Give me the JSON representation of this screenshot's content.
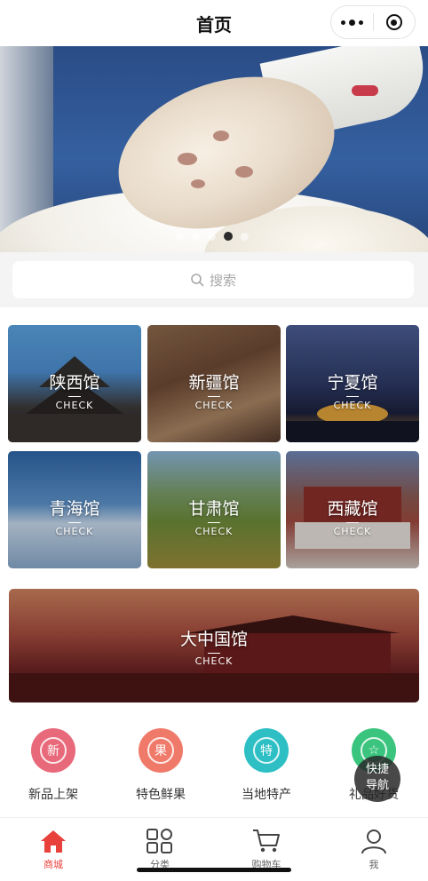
{
  "header": {
    "title": "首页"
  },
  "banner": {
    "slides_total": 5,
    "active_slide": 4
  },
  "search": {
    "placeholder": "搜索"
  },
  "pavilions": [
    {
      "name": "陕西馆",
      "action": "CHECK"
    },
    {
      "name": "新疆馆",
      "action": "CHECK"
    },
    {
      "name": "宁夏馆",
      "action": "CHECK"
    },
    {
      "name": "青海馆",
      "action": "CHECK"
    },
    {
      "name": "甘肃馆",
      "action": "CHECK"
    },
    {
      "name": "西藏馆",
      "action": "CHECK"
    }
  ],
  "featured": {
    "name": "大中国馆",
    "action": "CHECK"
  },
  "categories": [
    {
      "label": "新品上架",
      "glyph": "新",
      "color": "#e8697a"
    },
    {
      "label": "特色鲜果",
      "glyph": "果",
      "color": "#f07a6a"
    },
    {
      "label": "当地特产",
      "glyph": "特",
      "color": "#2dbfc4"
    },
    {
      "label": "礼品好货",
      "glyph": "☆",
      "color": "#3ac47d"
    }
  ],
  "quick_nav": {
    "line1": "快捷",
    "line2": "导航"
  },
  "tabbar": [
    {
      "label": "商城",
      "icon": "home-icon",
      "active": true
    },
    {
      "label": "分类",
      "icon": "grid-icon",
      "active": false
    },
    {
      "label": "购物车",
      "icon": "cart-icon",
      "active": false
    },
    {
      "label": "我",
      "icon": "user-icon",
      "active": false
    }
  ],
  "colors": {
    "accent": "#e8413b"
  }
}
